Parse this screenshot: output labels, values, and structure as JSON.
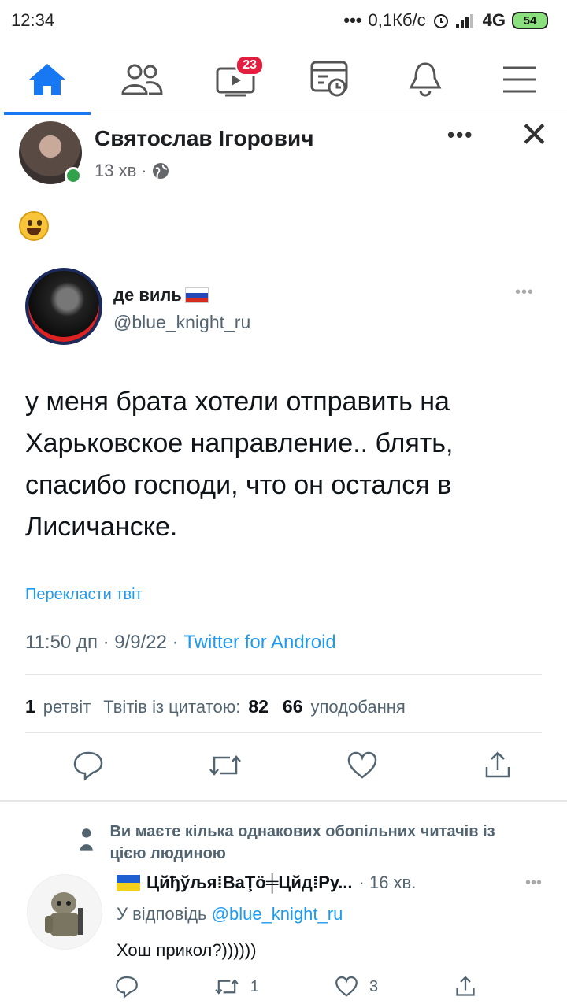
{
  "statusbar": {
    "time": "12:34",
    "dots": "•••",
    "speed": "0,1Кб/с",
    "network": "4G",
    "battery": "54"
  },
  "nav": {
    "video_badge": "23",
    "icons": [
      "home-icon",
      "friends-icon",
      "watch-icon",
      "news-icon",
      "bell-icon",
      "menu-icon"
    ],
    "accent": "#1877f2"
  },
  "post": {
    "author": "Святослав Ігорович",
    "time": "13 хв",
    "dot": "·",
    "more": "•••",
    "close": "✕"
  },
  "tweet": {
    "name": "де виль",
    "handle": "@blue_knight_ru",
    "text": "у меня брата хотели отправить на Харьковское направление.. блять, спасибо господи, что он остался в Лисичанске.",
    "translate": "Перекласти твіт",
    "meta_date": "11:50 дп · 9/9/22 · ",
    "source": "Twitter for Android",
    "retweets_count": "1",
    "retweets_label": "ретвіт",
    "quotes_label": "Твітів із цитатою:",
    "quotes_count": "82",
    "likes_count": "66",
    "likes_label": "уподобання",
    "accent": "#1d9bf0"
  },
  "reply": {
    "mutual": "Ви маєте кілька однакових обопільних читачів із цією людиною",
    "name": "Цйђўљя⁞ВаŢö╪Цйд⁞Ру...",
    "time": "· 16 хв.",
    "reply_prefix": "У відповідь ",
    "mention": "@blue_knight_ru",
    "text": "Хош прикол?))))))",
    "retweets": "1",
    "likes": "3"
  }
}
